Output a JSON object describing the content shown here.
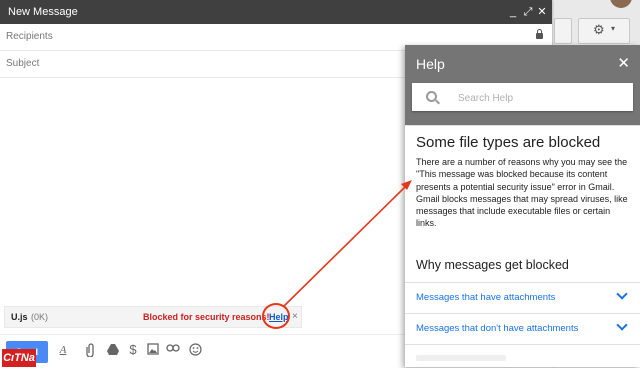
{
  "compose": {
    "title": "New Message",
    "controls": {
      "minimize": "_",
      "popout": "⤢",
      "close": "✕"
    },
    "recipients_placeholder": "Recipients",
    "subject_placeholder": "Subject",
    "attachment": {
      "filename": "U.js",
      "size": "(0K)",
      "blocked_text": "Blocked for security reasons!",
      "help_link": "Help",
      "remove": "×"
    },
    "toolbar": {
      "send_label": "Send",
      "icons": [
        "formatting-icon",
        "attach-icon",
        "drive-icon",
        "money-icon",
        "photo-icon",
        "link-icon",
        "emoji-icon"
      ]
    }
  },
  "help_panel": {
    "title": "Help",
    "close": "✕",
    "search_placeholder": "Search Help",
    "article_title": "Some file types are blocked",
    "article_body": "There are a number of reasons why you may see the \"This message was blocked because its content presents a potential security issue\" error in Gmail. Gmail blocks messages that may spread viruses, like messages that include executable files or certain links.",
    "section_title": "Why messages get blocked",
    "accordion": [
      {
        "label": "Messages that have attachments"
      },
      {
        "label": "Messages that don't have attachments"
      }
    ]
  },
  "watermark": "CıTNa",
  "colors": {
    "compose_header": "#404040",
    "help_header": "#757575",
    "send_button": "#4a8af4",
    "link": "#1a73e8",
    "blocked": "#cc1f1f",
    "annotation": "#e2381c"
  }
}
